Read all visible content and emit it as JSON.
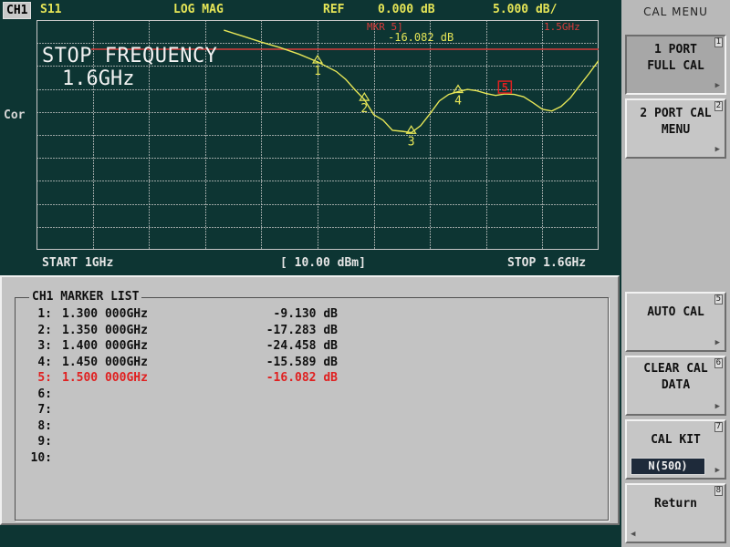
{
  "header": {
    "channel": "CH1",
    "param": "S11",
    "format": "LOG MAG",
    "ref_label": "REF",
    "ref_value": "0.000 dB",
    "scale": "5.000 dB/"
  },
  "side_label": "Cor",
  "active_marker": {
    "id": "MKR 5]",
    "value": "-16.082 dB",
    "freq": "1.5GHz"
  },
  "overlay": {
    "title": "STOP FREQUENCY",
    "value": "1.6GHz"
  },
  "footer": {
    "start": "START 1GHz",
    "power": "[ 10.00 dBm]",
    "stop": "STOP 1.6GHz"
  },
  "marker_list": {
    "title": "CH1 MARKER LIST",
    "rows": [
      {
        "idx": "1:",
        "freq": "1.300 000GHz",
        "value": "-9.130 dB"
      },
      {
        "idx": "2:",
        "freq": "1.350 000GHz",
        "value": "-17.283 dB"
      },
      {
        "idx": "3:",
        "freq": "1.400 000GHz",
        "value": "-24.458 dB"
      },
      {
        "idx": "4:",
        "freq": "1.450 000GHz",
        "value": "-15.589 dB"
      },
      {
        "idx": "5:",
        "freq": "1.500 000GHz",
        "value": "-16.082 dB"
      },
      {
        "idx": "6:",
        "freq": "",
        "value": ""
      },
      {
        "idx": "7:",
        "freq": "",
        "value": ""
      },
      {
        "idx": "8:",
        "freq": "",
        "value": ""
      },
      {
        "idx": "9:",
        "freq": "",
        "value": ""
      },
      {
        "idx": "10:",
        "freq": "",
        "value": ""
      }
    ],
    "active_index": 4
  },
  "menu": {
    "title": "CAL MENU",
    "keys": [
      {
        "label1": "1 PORT",
        "label2": "FULL CAL",
        "num": "1",
        "pressed": true
      },
      {
        "label1": "2 PORT CAL",
        "label2": "MENU",
        "num": "2"
      },
      {
        "label1": "AUTO CAL",
        "label2": "",
        "num": "5"
      },
      {
        "label1": "CLEAR CAL",
        "label2": "DATA",
        "num": "6"
      },
      {
        "label1": "CAL KIT",
        "label2": "",
        "num": "7",
        "sub": "N(50Ω)"
      },
      {
        "label1": "Return",
        "label2": "",
        "num": "8"
      }
    ]
  },
  "colors": {
    "screen_bg": "#0d3533",
    "trace": "#e6e657",
    "active_marker": "#e02020",
    "ref_line": "#d93b3b",
    "grid": "#c8c8c8",
    "panel": "#c3c3c3"
  },
  "chart_data": {
    "type": "line",
    "x_range": [
      1.0,
      1.6
    ],
    "ylim": [
      -50,
      0
    ],
    "x_unit": "GHz",
    "y_unit": "dB",
    "reference_level": 0,
    "grid": true,
    "series": [
      {
        "x": [
          1.2,
          1.22,
          1.24,
          1.26,
          1.28,
          1.3,
          1.32,
          1.33,
          1.34,
          1.35,
          1.36,
          1.37,
          1.38,
          1.39,
          1.4,
          1.41,
          1.42,
          1.43,
          1.44,
          1.45,
          1.46,
          1.47,
          1.48,
          1.49,
          1.5,
          1.51,
          1.52,
          1.53,
          1.54,
          1.55,
          1.56,
          1.57,
          1.58,
          1.59,
          1.6
        ],
        "y": [
          -2.2,
          -3.5,
          -4.8,
          -6.0,
          -7.4,
          -9.1,
          -11.2,
          -12.9,
          -15.2,
          -17.3,
          -20.6,
          -21.8,
          -24.0,
          -24.2,
          -24.5,
          -23.0,
          -20.4,
          -17.6,
          -16.2,
          -15.6,
          -15.1,
          -15.4,
          -16.0,
          -16.4,
          -16.1,
          -16.2,
          -16.7,
          -18.0,
          -19.4,
          -19.8,
          -18.8,
          -16.9,
          -14.2,
          -11.6,
          -8.8
        ]
      }
    ],
    "markers": [
      {
        "label": "1",
        "x": 1.3,
        "y": -9.13
      },
      {
        "label": "2",
        "x": 1.35,
        "y": -17.283
      },
      {
        "label": "3",
        "x": 1.4,
        "y": -24.458
      },
      {
        "label": "4",
        "x": 1.45,
        "y": -15.589
      },
      {
        "label": "5",
        "x": 1.5,
        "y": -16.082,
        "active": true
      }
    ]
  }
}
